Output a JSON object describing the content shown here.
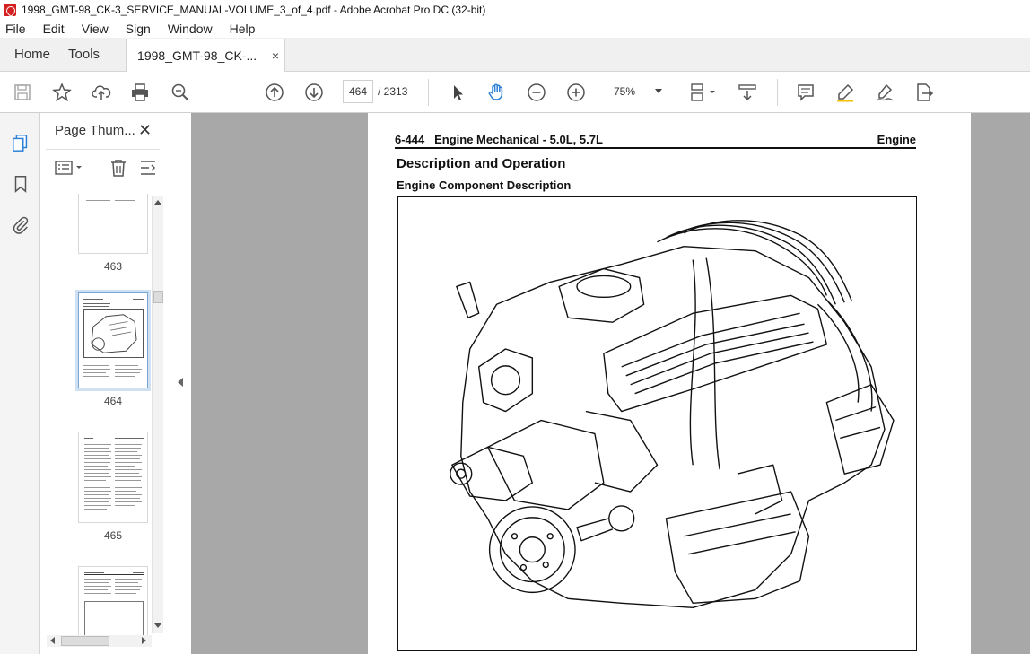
{
  "window": {
    "title": "1998_GMT-98_CK-3_SERVICE_MANUAL-VOLUME_3_of_4.pdf - Adobe Acrobat Pro DC (32-bit)"
  },
  "menu": [
    "File",
    "Edit",
    "View",
    "Sign",
    "Window",
    "Help"
  ],
  "tabs": {
    "home": "Home",
    "tools": "Tools",
    "document": "1998_GMT-98_CK-...",
    "close": "×"
  },
  "toolbar": {
    "page_current": "464",
    "page_total": "/ 2313",
    "zoom": "75%",
    "icons": [
      "save-icon",
      "bookmark-star-icon",
      "upload-icon",
      "print-icon",
      "zoom-search-icon",
      "page-up-icon",
      "page-down-icon",
      "select-cursor-icon",
      "hand-icon",
      "zoom-out-icon",
      "zoom-in-icon",
      "fit-page-icon",
      "scroll-mode-icon",
      "comment-icon",
      "highlight-pen-icon",
      "sign-icon",
      "export-icon"
    ]
  },
  "panel": {
    "title": "Page Thum...",
    "close": "✕",
    "thumbnails": [
      {
        "label": "463"
      },
      {
        "label": "464",
        "selected": true
      },
      {
        "label": "465"
      }
    ]
  },
  "page": {
    "header_left": "6-444   Engine Mechanical - 5.0L, 5.7L",
    "header_right": "Engine",
    "heading": "Description and Operation",
    "subheading": "Engine Component Description"
  },
  "colors": {
    "accent_red": "#d32020",
    "selection_blue": "#7aa6d6",
    "doc_background": "#a8a8a8"
  }
}
